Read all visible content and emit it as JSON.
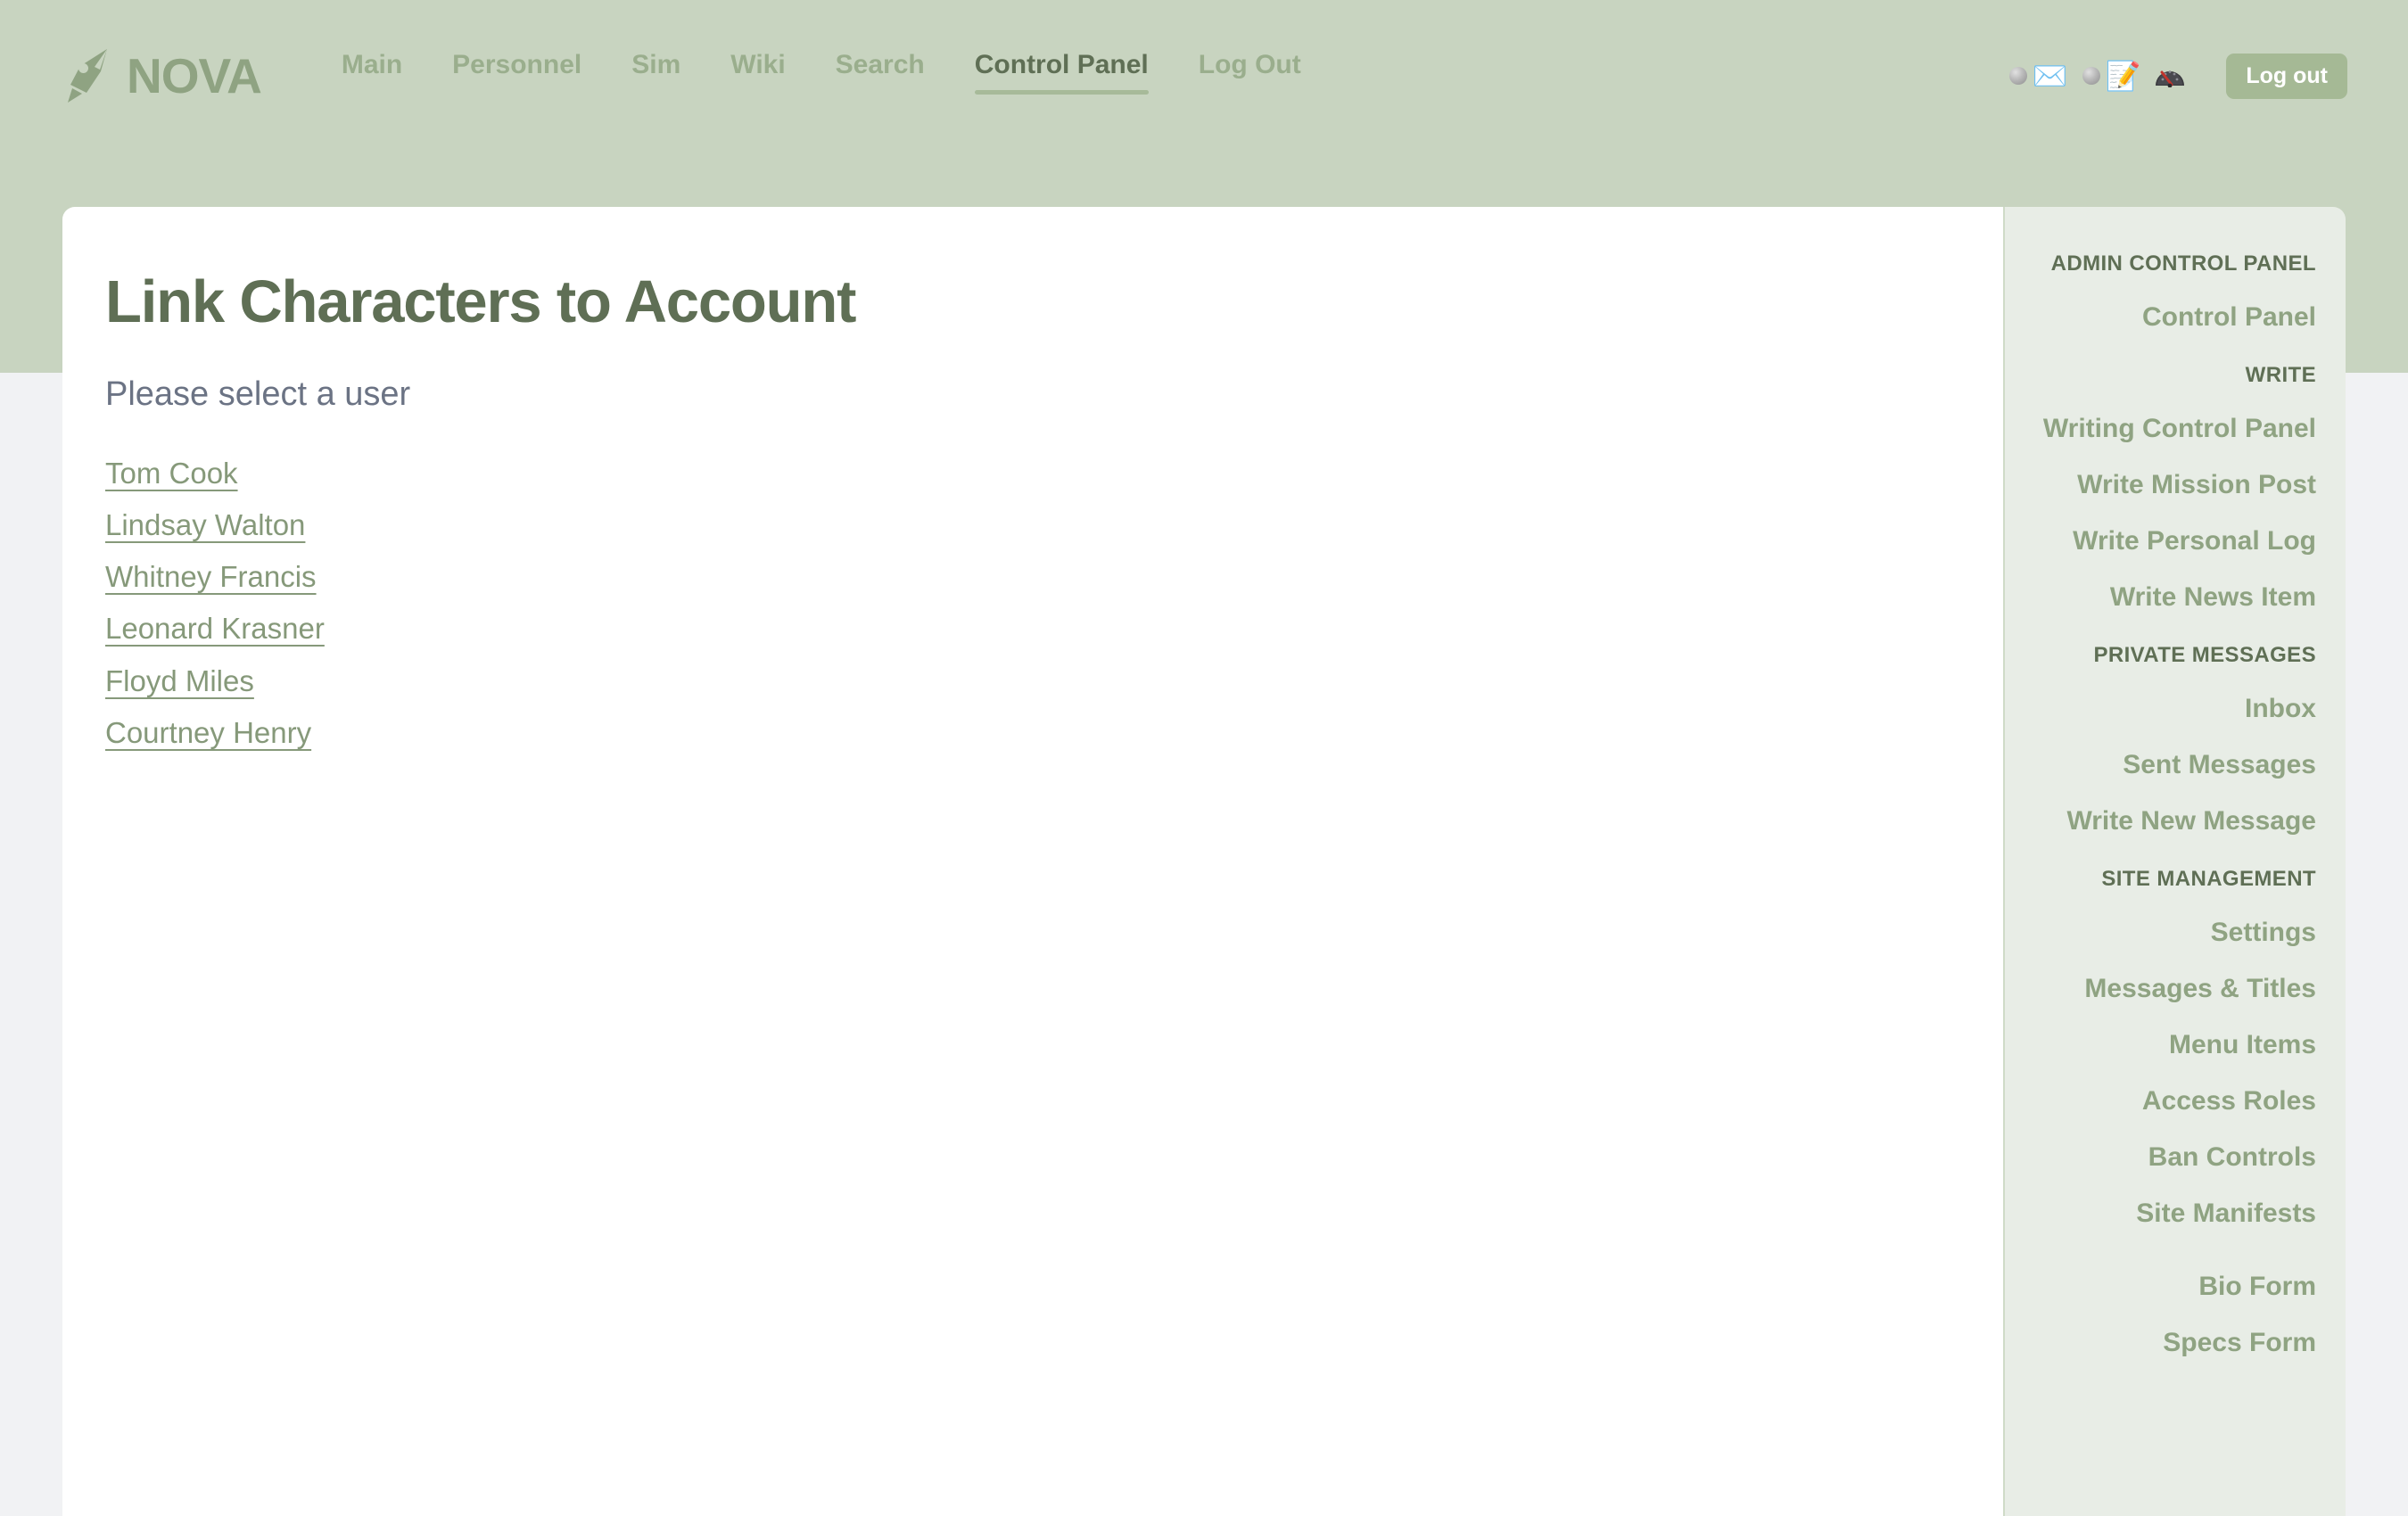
{
  "header": {
    "brand": {
      "word": "NOVA",
      "mark_icon": "pen-nib-icon"
    },
    "nav": [
      {
        "label": "Main",
        "active": false
      },
      {
        "label": "Personnel",
        "active": false
      },
      {
        "label": "Sim",
        "active": false
      },
      {
        "label": "Wiki",
        "active": false
      },
      {
        "label": "Search",
        "active": false
      },
      {
        "label": "Control Panel",
        "active": true
      },
      {
        "label": "Log Out",
        "active": false
      }
    ],
    "notifications": [
      {
        "icon": "envelope-icon",
        "glyph": "✉️"
      },
      {
        "icon": "notepad-pencil-icon",
        "glyph": "📝"
      }
    ],
    "status_icon": {
      "icon": "speedometer-icon",
      "glyph": "⏱"
    },
    "logout_label": "Log out",
    "colors": {
      "band": "#c8d4c0",
      "brand": "#8fa382",
      "nav_link": "#9aae8d",
      "nav_active": "#5f6f55",
      "logout_bg": "#a5b995"
    }
  },
  "main": {
    "title": "Link Characters to Account",
    "subtitle": "Please select a user",
    "users": [
      "Tom Cook",
      "Lindsay Walton",
      "Whitney Francis",
      "Leonard Krasner",
      "Floyd Miles",
      "Courtney Henry"
    ],
    "colors": {
      "card_bg": "#ffffff",
      "title": "#5f6f55",
      "subtitle": "#6b7384",
      "link": "#86997a"
    }
  },
  "sidebar": {
    "groups": [
      {
        "heading": "ADMIN CONTROL PANEL",
        "items": [
          {
            "label": "Control Panel"
          }
        ]
      },
      {
        "heading": "WRITE",
        "items": [
          {
            "label": "Writing Control Panel"
          },
          {
            "label": "Write Mission Post"
          },
          {
            "label": "Write Personal Log"
          },
          {
            "label": "Write News Item"
          }
        ]
      },
      {
        "heading": "PRIVATE MESSAGES",
        "items": [
          {
            "label": "Inbox"
          },
          {
            "label": "Sent Messages"
          },
          {
            "label": "Write New Message"
          }
        ]
      },
      {
        "heading": "SITE MANAGEMENT",
        "items": [
          {
            "label": "Settings"
          },
          {
            "label": "Messages & Titles"
          },
          {
            "label": "Menu Items"
          },
          {
            "label": "Access Roles"
          },
          {
            "label": "Ban Controls"
          },
          {
            "label": "Site Manifests"
          }
        ]
      },
      {
        "heading": "",
        "items": [
          {
            "label": "Bio Form"
          },
          {
            "label": "Specs Form"
          }
        ]
      }
    ],
    "colors": {
      "bg": "#e8ede6",
      "heading": "#5f6f55",
      "link": "#8fa382"
    }
  },
  "page": {
    "background": "#f1f2f4"
  }
}
